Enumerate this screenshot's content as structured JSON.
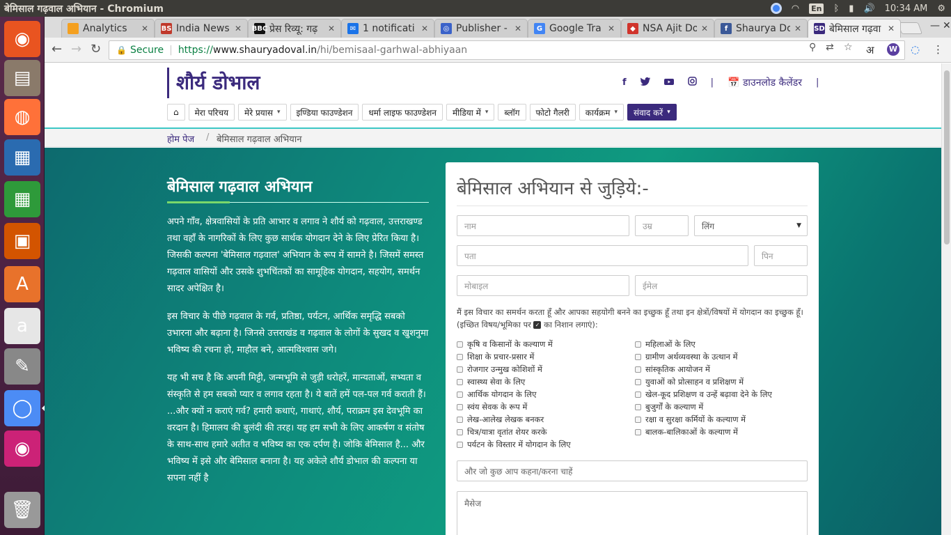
{
  "os": {
    "window_title": "बेमिसाल गढ़वाल अभियान - Chromium",
    "input_lang": "En",
    "clock": "10:34 AM"
  },
  "launcher": [
    {
      "name": "ubuntu-dash-icon",
      "color": "#e95420"
    },
    {
      "name": "files-icon",
      "color": "#8a7a6a"
    },
    {
      "name": "firefox-icon",
      "color": "#ff7139"
    },
    {
      "name": "writer-icon",
      "color": "#2a6bb0"
    },
    {
      "name": "calc-icon",
      "color": "#2e9a3a"
    },
    {
      "name": "impress-icon",
      "color": "#d35400"
    },
    {
      "name": "software-center-icon",
      "color": "#e8722b"
    },
    {
      "name": "amazon-icon",
      "color": "#e6e6e6"
    },
    {
      "name": "settings-icon",
      "color": "#888"
    },
    {
      "name": "chromium-icon",
      "color": "#4c8cf5"
    },
    {
      "name": "eye-app-icon",
      "color": "#cc2277"
    },
    {
      "name": "trash-icon",
      "color": "#999"
    }
  ],
  "tabs": [
    {
      "label": "Analytics",
      "fav": "",
      "fav_color": "#f4a020"
    },
    {
      "label": "India News",
      "fav": "BS",
      "fav_color": "#c0392b"
    },
    {
      "label": "प्रेस रिव्यू: गढ़",
      "fav": "BBC",
      "fav_color": "#111"
    },
    {
      "label": "1 notificati",
      "fav": "✉",
      "fav_color": "#1a73e8"
    },
    {
      "label": "Publisher -",
      "fav": "◎",
      "fav_color": "#3a62c9"
    },
    {
      "label": "Google Tra",
      "fav": "G",
      "fav_color": "#4285f4"
    },
    {
      "label": "NSA Ajit Do",
      "fav": "◆",
      "fav_color": "#d0342c"
    },
    {
      "label": "Shaurya Do",
      "fav": "f",
      "fav_color": "#3b5998"
    },
    {
      "label": "बेमिसाल गढ़वा",
      "fav": "SD",
      "fav_color": "#3b2a7d"
    }
  ],
  "omnibox": {
    "secure_label": "Secure",
    "url_scheme": "https://",
    "url_host": "www.shauryadoval.in",
    "url_path": "/hi/bemisaal-garhwal-abhiyaan"
  },
  "ext": {
    "hindi_label": "अ",
    "w_label": "W"
  },
  "site": {
    "logo": "शौर्य डोभाल",
    "download_label": "डाउनलोड कैलेंडर",
    "social": [
      "f",
      "🐦",
      "▶",
      "◎"
    ],
    "menu": [
      {
        "label": "⌂",
        "caret": false
      },
      {
        "label": "मेरा परिचय",
        "caret": false
      },
      {
        "label": "मेरे प्रयास",
        "caret": true
      },
      {
        "label": "इण्डिया फाउण्डेशन",
        "caret": false
      },
      {
        "label": "धर्मा लाइफ फाउण्डेशन",
        "caret": false
      },
      {
        "label": "मीडिया में",
        "caret": true
      },
      {
        "label": "ब्लॉग",
        "caret": false
      },
      {
        "label": "फोटो गैलरी",
        "caret": false
      },
      {
        "label": "कार्यक्रम",
        "caret": true
      },
      {
        "label": "संवाद करें",
        "caret": true,
        "cta": true
      }
    ],
    "breadcrumb": {
      "home": "होम पेज",
      "current": "बेमिसाल गढ़वाल अभियान"
    }
  },
  "article": {
    "title": "बेमिसाल गढ़वाल अभियान",
    "paragraphs": [
      "अपने गाँव, क्षेत्रवासियों के प्रति आभार व लगाव ने शौर्य को गढ़वाल, उत्तराखण्ड तथा वहाँ के नागरिकों के लिए कुछ सार्थक योगदान देने के लिए प्रेरित किया है। जिसकी कल्पना 'बेमिसाल गढ़वाल' अभियान के रूप में सामने है। जिसमें समस्त गढ़वाल वासियों और उसके शुभचिंतकों का सामूहिक योगदान, सहयोग, समर्थन सादर अपेक्षित है।",
      "इस विचार के पीछे गढ़वाल के गर्व, प्रतिष्ठा, पर्यटन, आर्थिक समृद्धि सबको उभारना और बढ़ाना है। जिनसे उत्तराखंड व गढ़वाल के लोगों के सुखद व खुशनुमा भविष्य की रचना हो, माहौल बने, आत्मविश्वास जगे।",
      "यह भी सच है कि अपनी मिट्टी, जन्मभूमि से जुड़ी धरोहरें, मान्यताओं, सभ्यता व संस्कृति से हम सबको प्यार व लगाव रहता है। ये बातें हमें पल-पल गर्व कराती हैं। ...और क्यों न कराएं गर्व? हमारी कथाएं, गाथाएं, शौर्य, पराक्रम इस देवभूमि का वरदान है। हिमालय की बुलंदी की तरह। यह हम सभी के लिए आकर्षण व संतोष के साथ-साथ हमारे अतीत व भविष्य का एक दर्पण है। जोकि बेमिसाल है... और भविष्य में इसे और बेमिसाल बनाना है। यह अकेले शौर्य डोभाल की कल्पना या सपना नहीं है"
    ]
  },
  "form": {
    "title": "बेमिसाल अभियान से जुड़िये:-",
    "name_ph": "नाम",
    "age_ph": "उम्र",
    "gender_ph": "लिंग",
    "address_ph": "पता",
    "pin_ph": "पिन",
    "mobile_ph": "मोबाइल",
    "email_ph": "ईमेल",
    "hint_a": "मैं इस विचार का समर्थन करता हूँ और आपका सहयोगी बनने का इच्छुक हूँ तथा इन क्षेत्रों/विषयों में योगदान का इच्छुक हूँ। (इच्छित विषय/भूमिका पर",
    "hint_b": "का निशान लगाएं):",
    "checks_left": [
      "कृषि व किसानों के कल्याण में",
      "शिक्षा के प्रचार-प्रसार में",
      "रोजगार उन्मुख कोशिशों में",
      "स्वास्थ्य सेवा के लिए",
      "आर्थिक योगदान के लिए",
      "स्वंय सेवक के रूप में",
      "लेख-आलेख लेखक बनकर",
      "चित्र/यात्रा वृतांत शेयर करके",
      "पर्यटन के विस्तार में योगदान के लिए"
    ],
    "checks_right": [
      "महिलाओं के लिए",
      "ग्रामीण अर्थव्यवस्था के उत्थान में",
      "सांस्कृतिक आयोजन में",
      "युवाओं को प्रोत्साहन व प्रशिक्षण में",
      "खेल-कूद प्रशिक्षण व उन्हें बढ़ावा देने के लिए",
      "बुजुर्गों के कल्याण में",
      "रक्षा व सुरक्षा कर्मियों के कल्याण में",
      "बालक-बालिकाओं के कल्याण में"
    ],
    "more_ph": "और जो कुछ आप कहना/करना चाहें",
    "message_ph": "मैसेज"
  }
}
